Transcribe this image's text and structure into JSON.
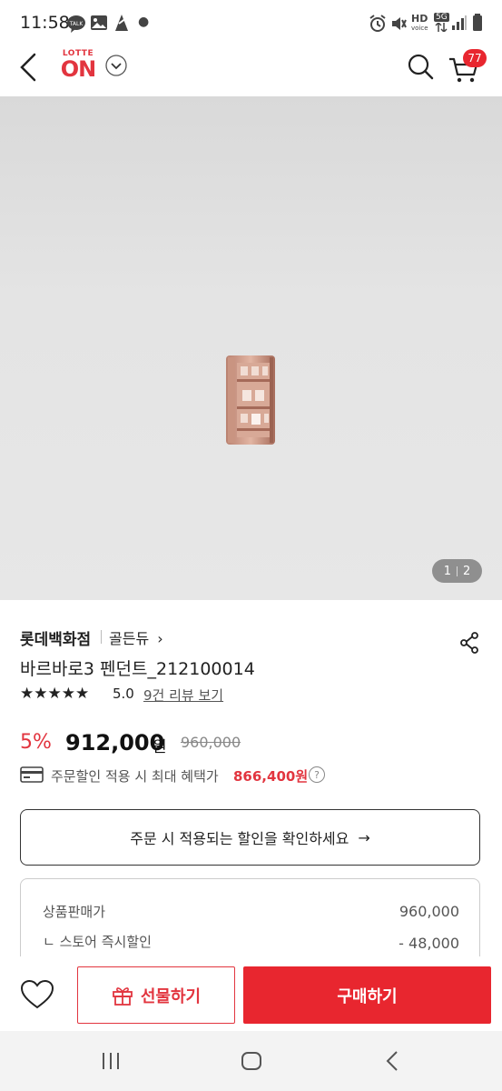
{
  "status_bar": {
    "time": "11:58",
    "hd_label": "HD",
    "voice_label": "voice",
    "network": "5G"
  },
  "header": {
    "logo_top": "LOTTE",
    "logo_main": "ON",
    "cart_count": "77"
  },
  "gallery": {
    "current": "1",
    "total": "2"
  },
  "product": {
    "brand": "롯데백화점",
    "store": "골든듀",
    "store_chevron": "›",
    "title": "바르바로3 펜던트_212100014",
    "stars": "★★★★★",
    "rating": "5.0",
    "reviews": "9건 리뷰 보기",
    "discount": "5%",
    "price": "912,000",
    "won": "원",
    "original_price": "960,000",
    "benefit_label": "주문할인 적용 시 최대 혜택가",
    "benefit_amount": "866,400원",
    "benefit_help": "?"
  },
  "confirm_button": {
    "label": "주문 시 적용되는 할인을 확인하세요",
    "arrow": "→"
  },
  "price_breakdown": [
    {
      "label": "상품판매가",
      "value": "960,000"
    },
    {
      "label": "ㄴ 스토어 즉시할인",
      "value": "- 48,000"
    }
  ],
  "actions": {
    "gift_label": "선물하기",
    "buy_label": "구매하기"
  },
  "colors": {
    "accent": "#e8262f",
    "discount": "#e2353f",
    "badge": "#e8262f"
  }
}
